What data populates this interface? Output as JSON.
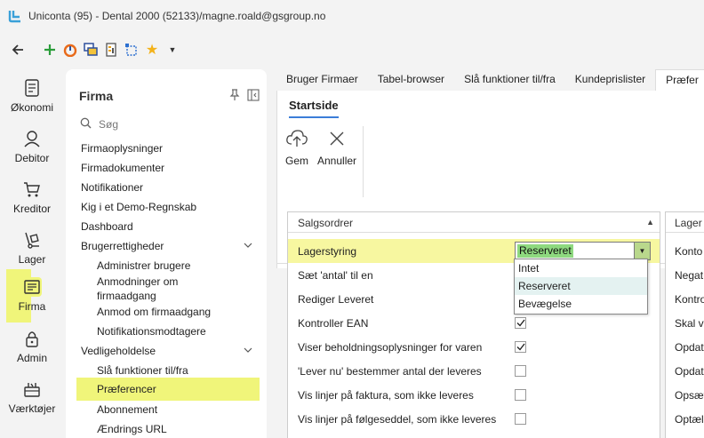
{
  "window": {
    "title": "Uniconta (95)  - Dental 2000 (52133)/magne.roald@gsgroup.no"
  },
  "toolbar": {
    "icons": [
      "back-arrow-icon",
      "add-icon",
      "gauge-icon",
      "windows-icon",
      "report-icon",
      "select-icon",
      "favorite-star-icon",
      "dropdown-caret-icon"
    ]
  },
  "leftnav": {
    "items": [
      {
        "label": "Økonomi",
        "icon": "ledger-icon"
      },
      {
        "label": "Debitor",
        "icon": "person-icon"
      },
      {
        "label": "Kreditor",
        "icon": "cart-icon"
      },
      {
        "label": "Lager",
        "icon": "hand-truck-icon"
      },
      {
        "label": "Firma",
        "icon": "company-icon"
      },
      {
        "label": "Admin",
        "icon": "lock-icon"
      },
      {
        "label": "Værktøjer",
        "icon": "toolbox-icon"
      }
    ]
  },
  "panel": {
    "title": "Firma",
    "search_placeholder": "Søg",
    "items": [
      {
        "label": "Firmaoplysninger"
      },
      {
        "label": "Firmadokumenter"
      },
      {
        "label": "Notifikationer"
      },
      {
        "label": "Kig i et Demo-Regnskab"
      },
      {
        "label": "Dashboard"
      },
      {
        "label": "Brugerrettigheder"
      },
      {
        "label": "Administrer brugere"
      },
      {
        "label": "Anmodninger om"
      },
      {
        "label": "firmaadgang"
      },
      {
        "label": "Anmod om firmaadgang"
      },
      {
        "label": "Notifikationsmodtagere"
      },
      {
        "label": "Vedligeholdelse"
      },
      {
        "label": "Slå funktioner til/fra"
      },
      {
        "label": "Præferencer"
      },
      {
        "label": "Abonnement"
      },
      {
        "label": "Ændrings URL"
      }
    ]
  },
  "tabs": [
    "Bruger Firmaer",
    "Tabel-browser",
    "Slå funktioner til/fra",
    "Kundeprislister",
    "Præfer"
  ],
  "ribbon": {
    "tab": "Startside",
    "save": "Gem",
    "cancel": "Annuller"
  },
  "group": {
    "title": "Salgsordrer",
    "rows": [
      {
        "label": "Lagerstyring"
      },
      {
        "label": "Sæt 'antal' til en"
      },
      {
        "label": "Rediger Leveret"
      },
      {
        "label": "Kontroller EAN",
        "checked": true
      },
      {
        "label": "Viser beholdningsoplysninger for varen",
        "checked": true
      },
      {
        "label": "'Lever nu' bestemmer antal der leveres",
        "checked": false
      },
      {
        "label": "Vis linjer på faktura, som ikke leveres",
        "checked": false
      },
      {
        "label": "Vis linjer på følgeseddel, som ikke leveres",
        "checked": false
      }
    ],
    "combo_value": "Reserveret",
    "dropdown_options": [
      "Intet",
      "Reserveret",
      "Bevægelse"
    ]
  },
  "group2": {
    "title": "Lager",
    "rows": [
      "Konto",
      "Negat",
      "Kontro",
      "Skal va",
      "Opdat",
      "Opdat",
      "Opsæt",
      "Optæl"
    ]
  },
  "colors": {
    "highlight": "#f0f57a",
    "combo_value_bg": "#8ed97f",
    "accent": "#3b7dd8"
  }
}
